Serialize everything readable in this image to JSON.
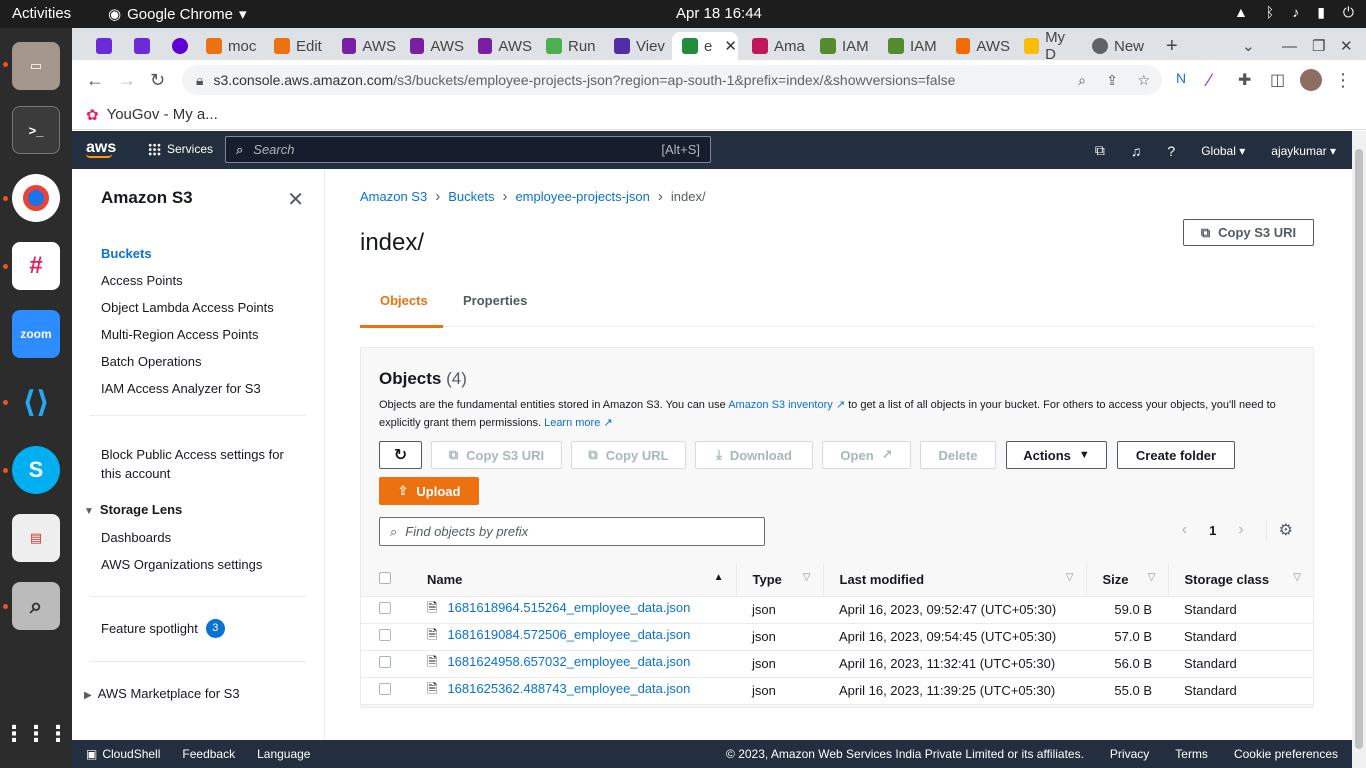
{
  "os": {
    "activities": "Activities",
    "app_name": "Google Chrome",
    "datetime": "Apr 18  16:44"
  },
  "browser": {
    "tabs": [
      {
        "label": ""
      },
      {
        "label": ""
      },
      {
        "label": ""
      },
      {
        "label": "moc"
      },
      {
        "label": "Edit"
      },
      {
        "label": "AWS"
      },
      {
        "label": "AWS"
      },
      {
        "label": "AWS"
      },
      {
        "label": "Run"
      },
      {
        "label": "Viev"
      },
      {
        "label": "e"
      },
      {
        "label": "Ama"
      },
      {
        "label": "IAM"
      },
      {
        "label": "IAM"
      },
      {
        "label": "AWS"
      },
      {
        "label": "My D"
      },
      {
        "label": "New"
      }
    ],
    "url_host": "s3.console.aws.amazon.com",
    "url_path": "/s3/buckets/employee-projects-json?region=ap-south-1&prefix=index/&showversions=false",
    "bookmark": "YouGov - My a..."
  },
  "aws": {
    "logo": "aws",
    "services": "Services",
    "search_placeholder": "Search",
    "search_shortcut": "[Alt+S]",
    "region": "Global",
    "user": "ajaykumar"
  },
  "sidebar": {
    "title": "Amazon S3",
    "links": [
      "Buckets",
      "Access Points",
      "Object Lambda Access Points",
      "Multi-Region Access Points",
      "Batch Operations",
      "IAM Access Analyzer for S3"
    ],
    "block_public_1": "Block Public Access settings for",
    "block_public_2": "this account",
    "storage_lens": "Storage Lens",
    "dashboards": "Dashboards",
    "aws_org": "AWS Organizations settings",
    "feature_spotlight": "Feature spotlight",
    "feature_badge": "3",
    "marketplace": "AWS Marketplace for S3"
  },
  "breadcrumb": {
    "items": [
      "Amazon S3",
      "Buckets",
      "employee-projects-json"
    ],
    "current": "index/"
  },
  "page": {
    "title": "index/",
    "copy_s3_uri": "Copy S3 URI",
    "tab_objects": "Objects",
    "tab_properties": "Properties"
  },
  "objects_panel": {
    "heading": "Objects",
    "count": "(4)",
    "desc_1": "Objects are the fundamental entities stored in Amazon S3. You can use",
    "desc_link": "Amazon S3 inventory",
    "desc_2": "to get a list of all objects in your bucket. For others to access your objects, you'll need to explicitly grant them permissions.",
    "learn_more": "Learn more",
    "btn_copy_uri": "Copy S3 URI",
    "btn_copy_url": "Copy URL",
    "btn_download": "Download",
    "btn_open": "Open",
    "btn_delete": "Delete",
    "btn_actions": "Actions",
    "btn_create_folder": "Create folder",
    "btn_upload": "Upload",
    "find_placeholder": "Find objects by prefix",
    "page_num": "1",
    "columns": [
      "Name",
      "Type",
      "Last modified",
      "Size",
      "Storage class"
    ],
    "rows": [
      {
        "name": "1681618964.515264_employee_data.json",
        "type": "json",
        "modified": "April 16, 2023, 09:52:47 (UTC+05:30)",
        "size": "59.0 B",
        "class": "Standard"
      },
      {
        "name": "1681619084.572506_employee_data.json",
        "type": "json",
        "modified": "April 16, 2023, 09:54:45 (UTC+05:30)",
        "size": "57.0 B",
        "class": "Standard"
      },
      {
        "name": "1681624958.657032_employee_data.json",
        "type": "json",
        "modified": "April 16, 2023, 11:32:41 (UTC+05:30)",
        "size": "56.0 B",
        "class": "Standard"
      },
      {
        "name": "1681625362.488743_employee_data.json",
        "type": "json",
        "modified": "April 16, 2023, 11:39:25 (UTC+05:30)",
        "size": "55.0 B",
        "class": "Standard"
      }
    ]
  },
  "footer": {
    "cloudshell": "CloudShell",
    "feedback": "Feedback",
    "language": "Language",
    "copyright": "© 2023, Amazon Web Services India Private Limited or its affiliates.",
    "privacy": "Privacy",
    "terms": "Terms",
    "cookies": "Cookie preferences"
  }
}
